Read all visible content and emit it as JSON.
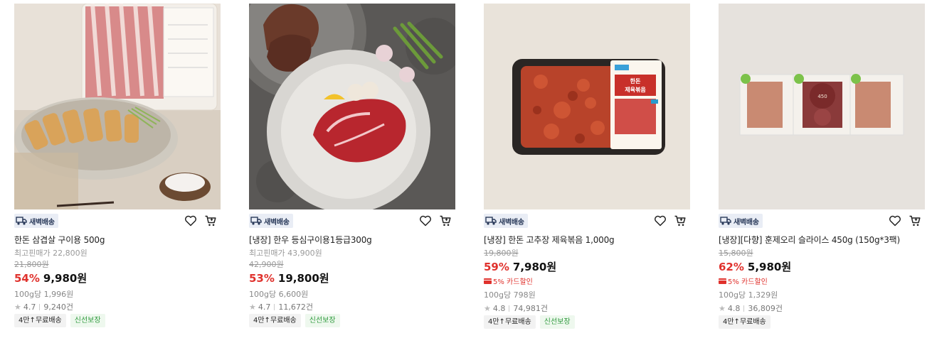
{
  "products": [
    {
      "badge": "새벽배송",
      "name": "한돈 삼겹살 구이용 500g",
      "lowest_price": "최고핀매가 22,800원",
      "original_price": "21,800원",
      "discount": "54%",
      "sale_price": "9,980원",
      "card_discount": "",
      "unit_price": "100g당 1,996원",
      "rating": "4.7",
      "review_count": "9,240건",
      "tags": [
        "4만↑무료배송",
        "신선보장"
      ],
      "image_icon": "pork-belly-image"
    },
    {
      "badge": "새벽배송",
      "name": "[냉장] 한우 등심구이용1등급300g",
      "lowest_price": "최고핀매가 43,900원",
      "original_price": "42,900원",
      "discount": "53%",
      "sale_price": "19,800원",
      "card_discount": "",
      "unit_price": "100g당 6,600원",
      "rating": "4.7",
      "review_count": "11,672건",
      "tags": [
        "4만↑무료배송",
        "신선보장"
      ],
      "image_icon": "beef-sirloin-image"
    },
    {
      "badge": "새벽배송",
      "name": "[냉장] 한돈 고추장 제육볶음 1,000g",
      "lowest_price": "",
      "original_price": "19,800원",
      "discount": "59%",
      "sale_price": "7,980원",
      "card_discount": "5% 카드할인",
      "unit_price": "100g당 798원",
      "rating": "4.8",
      "review_count": "74,981건",
      "tags": [
        "4만↑무료배송",
        "신선보장"
      ],
      "image_icon": "spicy-pork-image",
      "package_label": "한돈 제육볶음"
    },
    {
      "badge": "새벽배송",
      "name": "[냉장][다향] 훈제오리 슬라이스 450g (150g*3팩)",
      "lowest_price": "",
      "original_price": "15,800원",
      "discount": "62%",
      "sale_price": "5,980원",
      "card_discount": "5% 카드할인",
      "unit_price": "100g당 1,329원",
      "rating": "4.8",
      "review_count": "36,809건",
      "tags": [
        "4만↑무료배송"
      ],
      "image_icon": "smoked-duck-image",
      "package_label": "다향오리 450"
    }
  ],
  "colors": {
    "discount": "#e0322d",
    "badge_bg": "#e9edf5",
    "fresh_tag": "#2f9a3d"
  },
  "icons": {
    "wish": "heart-icon",
    "cart": "cart-icon",
    "delivery": "delivery-truck-icon",
    "rating": "star-icon"
  }
}
